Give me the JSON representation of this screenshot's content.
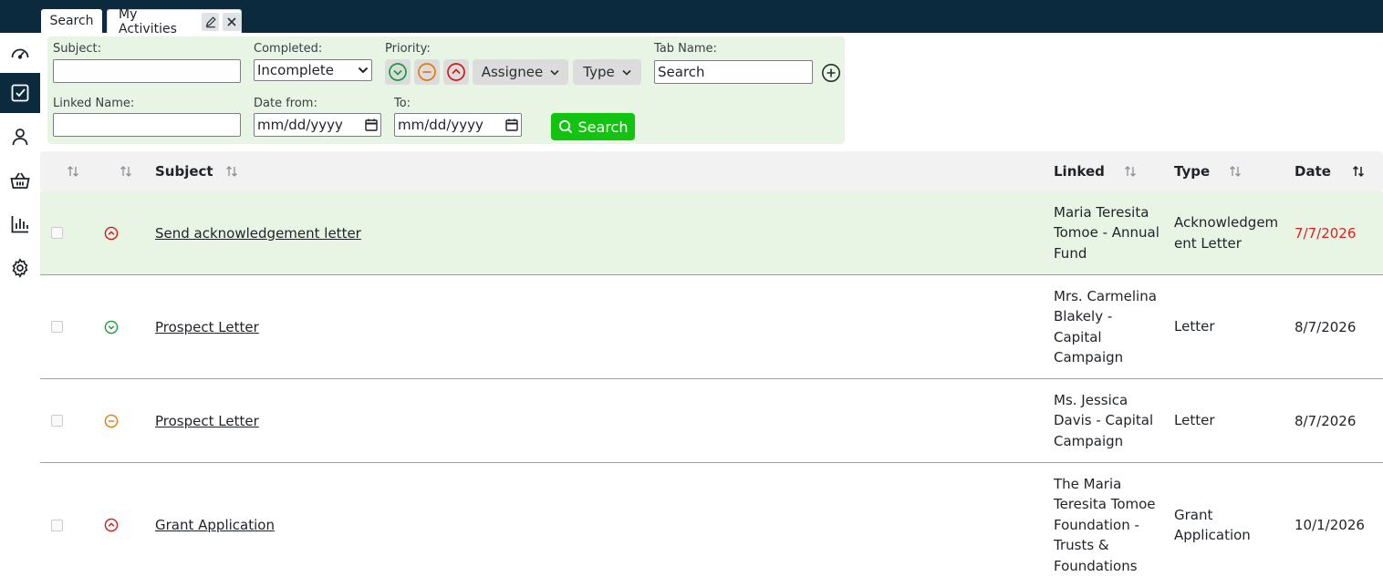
{
  "tabs": [
    {
      "label": "Search"
    },
    {
      "label": "My Activities"
    }
  ],
  "sidebar": {
    "items": [
      {
        "icon": "dashboard-icon"
      },
      {
        "icon": "checklist-icon",
        "active": true
      },
      {
        "icon": "person-icon"
      },
      {
        "icon": "basket-icon"
      },
      {
        "icon": "bar-chart-icon"
      },
      {
        "icon": "gear-icon"
      }
    ]
  },
  "filters": {
    "subject_label": "Subject:",
    "subject_value": "",
    "completed_label": "Completed:",
    "completed_value": "Incomplete",
    "priority_label": "Priority:",
    "assignee_label": "Assignee",
    "type_label": "Type",
    "tabname_label": "Tab Name:",
    "tabname_value": "Search",
    "linked_label": "Linked Name:",
    "linked_value": "",
    "datefrom_label": "Date from:",
    "datefrom_placeholder": "mm/dd/yyyy",
    "to_label": "To:",
    "to_placeholder": "mm/dd/yyyy",
    "search_button": "Search"
  },
  "table": {
    "headers": {
      "subject": "Subject",
      "linked": "Linked",
      "type": "Type",
      "date": "Date"
    },
    "rows": [
      {
        "priority": "high",
        "subject": "Send acknowledgement letter",
        "linked": "Maria Teresita Tomoe - Annual Fund",
        "type": "Acknowledgement Letter",
        "date": "7/7/2026",
        "overdue": true,
        "highlight": true
      },
      {
        "priority": "low",
        "subject": "Prospect Letter",
        "linked": "Mrs. Carmelina Blakely - Capital Campaign",
        "type": "Letter",
        "date": "8/7/2026",
        "overdue": false,
        "highlight": false
      },
      {
        "priority": "medium",
        "subject": "Prospect Letter",
        "linked": "Ms. Jessica Davis - Capital Campaign",
        "type": "Letter",
        "date": "8/7/2026",
        "overdue": false,
        "highlight": false
      },
      {
        "priority": "high",
        "subject": "Grant Application",
        "linked": "The Maria Teresita Tomoe Foundation - Trusts & Foundations",
        "type": "Grant Application",
        "date": "10/1/2026",
        "overdue": false,
        "highlight": false
      }
    ]
  },
  "colors": {
    "topbar": "#0b2a3d",
    "panel": "#e8f4e4",
    "search_button": "#12c40f",
    "priority_high": "#d11a1a",
    "priority_medium": "#e07b12",
    "priority_low": "#1a9a3a",
    "overdue": "#e02020"
  }
}
